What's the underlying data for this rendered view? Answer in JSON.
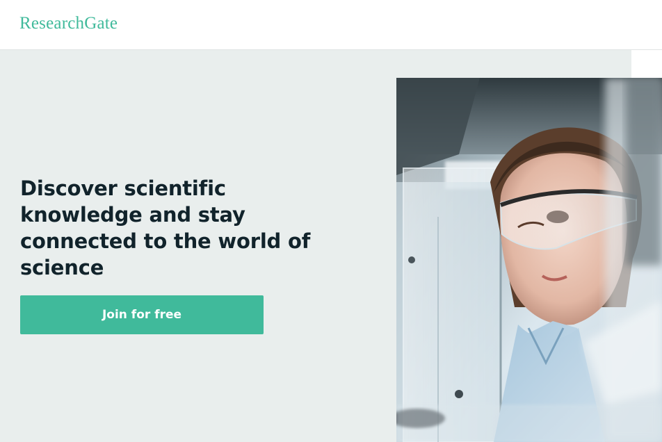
{
  "header": {
    "logo_text": "ResearchGate"
  },
  "hero": {
    "headline": "Discover scientific knowledge and stay connected to the world of science",
    "cta_label": "Join for free"
  },
  "colors": {
    "brand": "#40ba9b",
    "hero_background": "#e9eeed",
    "headline_text": "#11232b"
  },
  "image": {
    "description_icon": "scientist-in-lab-photo"
  }
}
